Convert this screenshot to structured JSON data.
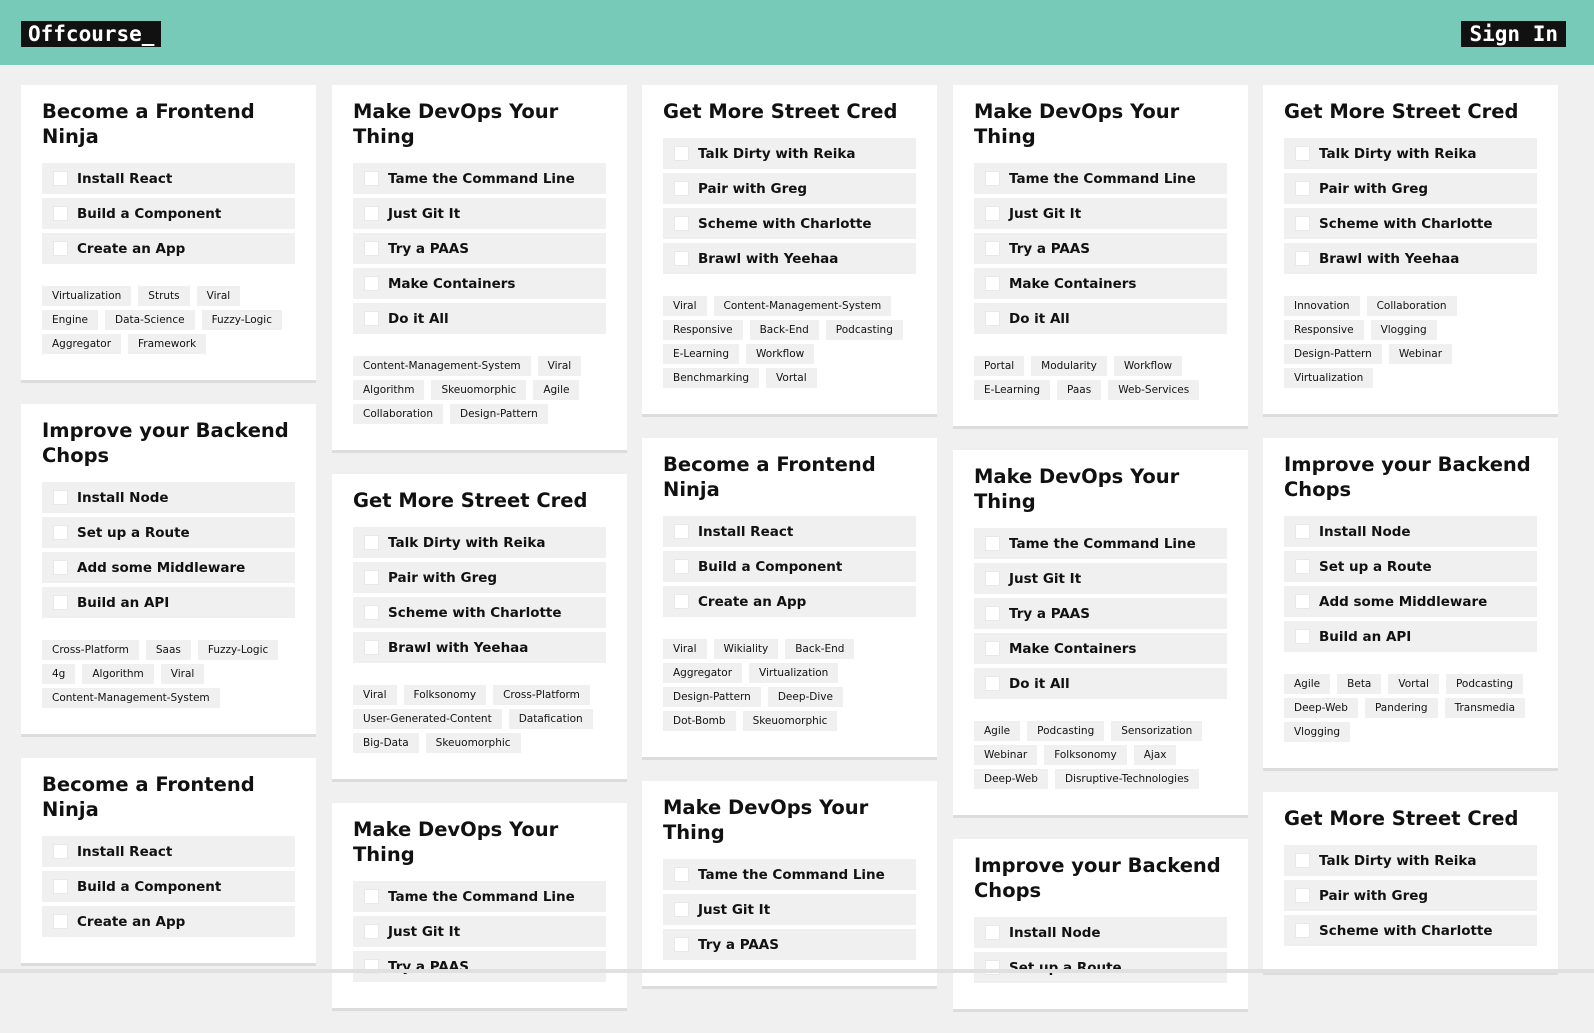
{
  "header": {
    "logo": "Offcourse_",
    "sign_in": "Sign In"
  },
  "columns": [
    [
      {
        "title": "Become a Frontend Ninja",
        "items": [
          "Install React",
          "Build a Component",
          "Create an App"
        ],
        "tags": [
          "Virtualization",
          "Struts",
          "Viral",
          "Engine",
          "Data-Science",
          "Fuzzy-Logic",
          "Aggregator",
          "Framework"
        ]
      },
      {
        "title": "Improve your Backend Chops",
        "items": [
          "Install Node",
          "Set up a Route",
          "Add some Middleware",
          "Build an API"
        ],
        "tags": [
          "Cross-Platform",
          "Saas",
          "Fuzzy-Logic",
          "4g",
          "Algorithm",
          "Viral",
          "Content-Management-System"
        ]
      },
      {
        "title": "Become a Frontend Ninja",
        "items": [
          "Install React",
          "Build a Component",
          "Create an App"
        ],
        "tags": []
      }
    ],
    [
      {
        "title": "Make DevOps Your Thing",
        "items": [
          "Tame the Command Line",
          "Just Git It",
          "Try a PAAS",
          "Make Containers",
          "Do it All"
        ],
        "tags": [
          "Content-Management-System",
          "Viral",
          "Algorithm",
          "Skeuomorphic",
          "Agile",
          "Collaboration",
          "Design-Pattern"
        ]
      },
      {
        "title": "Get More Street Cred",
        "items": [
          "Talk Dirty with Reika",
          "Pair with Greg",
          "Scheme with Charlotte",
          "Brawl with Yeehaa"
        ],
        "tags": [
          "Viral",
          "Folksonomy",
          "Cross-Platform",
          "User-Generated-Content",
          "Datafication",
          "Big-Data",
          "Skeuomorphic"
        ]
      },
      {
        "title": "Make DevOps Your Thing",
        "items": [
          "Tame the Command Line",
          "Just Git It",
          "Try a PAAS"
        ],
        "tags": []
      }
    ],
    [
      {
        "title": "Get More Street Cred",
        "items": [
          "Talk Dirty with Reika",
          "Pair with Greg",
          "Scheme with Charlotte",
          "Brawl with Yeehaa"
        ],
        "tags": [
          "Viral",
          "Content-Management-System",
          "Responsive",
          "Back-End",
          "Podcasting",
          "E-Learning",
          "Workflow",
          "Benchmarking",
          "Vortal"
        ]
      },
      {
        "title": "Become a Frontend Ninja",
        "items": [
          "Install React",
          "Build a Component",
          "Create an App"
        ],
        "tags": [
          "Viral",
          "Wikiality",
          "Back-End",
          "Aggregator",
          "Virtualization",
          "Design-Pattern",
          "Deep-Dive",
          "Dot-Bomb",
          "Skeuomorphic"
        ]
      },
      {
        "title": "Make DevOps Your Thing",
        "items": [
          "Tame the Command Line",
          "Just Git It",
          "Try a PAAS"
        ],
        "tags": []
      }
    ],
    [
      {
        "title": "Make DevOps Your Thing",
        "items": [
          "Tame the Command Line",
          "Just Git It",
          "Try a PAAS",
          "Make Containers",
          "Do it All"
        ],
        "tags": [
          "Portal",
          "Modularity",
          "Workflow",
          "E-Learning",
          "Paas",
          "Web-Services"
        ]
      },
      {
        "title": "Make DevOps Your Thing",
        "items": [
          "Tame the Command Line",
          "Just Git It",
          "Try a PAAS",
          "Make Containers",
          "Do it All"
        ],
        "tags": [
          "Agile",
          "Podcasting",
          "Sensorization",
          "Webinar",
          "Folksonomy",
          "Ajax",
          "Deep-Web",
          "Disruptive-Technologies"
        ]
      },
      {
        "title": "Improve your Backend Chops",
        "items": [
          "Install Node",
          "Set up a Route"
        ],
        "tags": []
      }
    ],
    [
      {
        "title": "Get More Street Cred",
        "items": [
          "Talk Dirty with Reika",
          "Pair with Greg",
          "Scheme with Charlotte",
          "Brawl with Yeehaa"
        ],
        "tags": [
          "Innovation",
          "Collaboration",
          "Responsive",
          "Vlogging",
          "Design-Pattern",
          "Webinar",
          "Virtualization"
        ]
      },
      {
        "title": "Improve your Backend Chops",
        "items": [
          "Install Node",
          "Set up a Route",
          "Add some Middleware",
          "Build an API"
        ],
        "tags": [
          "Agile",
          "Beta",
          "Vortal",
          "Podcasting",
          "Deep-Web",
          "Pandering",
          "Transmedia",
          "Vlogging"
        ]
      },
      {
        "title": "Get More Street Cred",
        "items": [
          "Talk Dirty with Reika",
          "Pair with Greg",
          "Scheme with Charlotte"
        ],
        "tags": []
      }
    ]
  ]
}
